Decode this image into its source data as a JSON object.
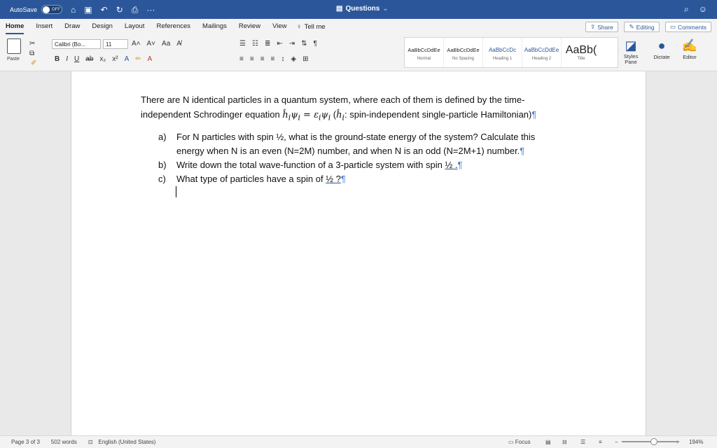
{
  "titlebar": {
    "autosave_label": "AutoSave",
    "toggle_label": "OFF",
    "doc_title": "Questions",
    "doc_title_chevron": "⌄"
  },
  "menu": [
    "Home",
    "Insert",
    "Draw",
    "Design",
    "Layout",
    "References",
    "Mailings",
    "Review",
    "View"
  ],
  "tellme_label": "Tell me",
  "share_label": "Share",
  "editing_label": "Editing",
  "comments_label": "Comments",
  "ribbon": {
    "paste_label": "Paste",
    "font_name": "Calibri (Bo...",
    "font_size": "11",
    "styles": [
      {
        "preview": "AaBbCcDdEe",
        "name": "Normal"
      },
      {
        "preview": "AaBbCcDdEe",
        "name": "No Spacing"
      },
      {
        "preview": "AaBbCcDc",
        "name": "Heading 1"
      },
      {
        "preview": "AaBbCcDdEe",
        "name": "Heading 2"
      },
      {
        "preview": "AaBb(",
        "name": "Title"
      }
    ],
    "styles_pane_label": "Styles Pane",
    "dictate_label": "Dictate",
    "editor_label": "Editor"
  },
  "document": {
    "intro_1": "There are N identical particles in a quantum system, where each of them is defined by the time-",
    "intro_2a": "independent Schrodinger equation ",
    "intro_math": "ĥ",
    "intro_2b": " (",
    "intro_2c": ": spin-independent single-particle Hamiltonian)",
    "items": [
      {
        "marker": "a)",
        "line1": "For N particles with spin ½, what is the ground-state energy of the system? Calculate this",
        "line2": "energy when N is an even (N=2M) number, and when N is an odd (N=2M+1) number."
      },
      {
        "marker": "b)",
        "line1": "Write down the total wave-function of a 3-particle system with spin ",
        "underlined": "½ .",
        "line2": ""
      },
      {
        "marker": "c)",
        "line1": "What type of particles have a spin of ",
        "underlined": "½ ?",
        "line2": ""
      }
    ],
    "pilcrow": "¶"
  },
  "status": {
    "page": "Page 3 of 3",
    "words": "502 words",
    "language": "English (United States)",
    "focus": "Focus",
    "zoom": "194%"
  }
}
